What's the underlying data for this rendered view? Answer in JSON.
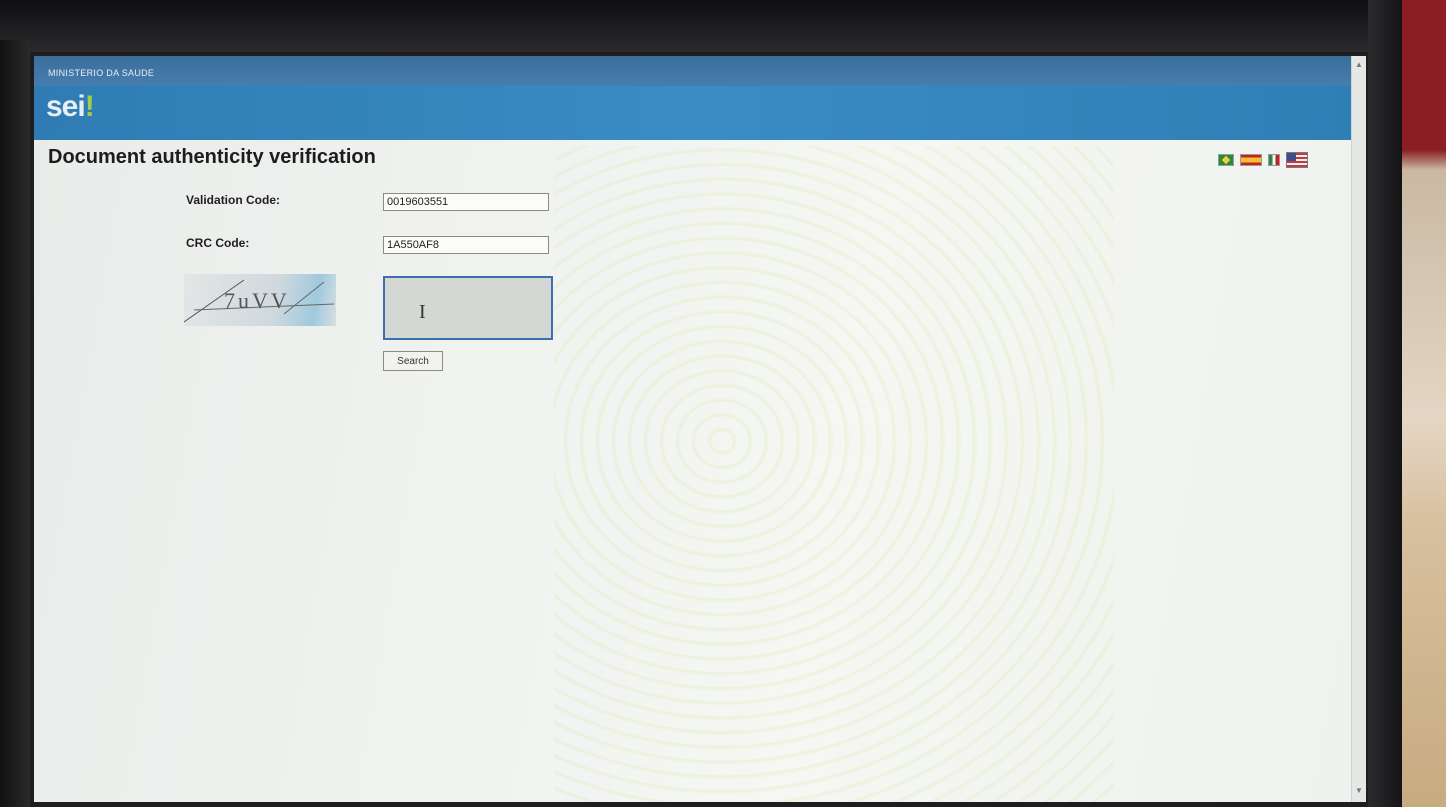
{
  "header": {
    "ministry": "MINISTERIO DA SAUDE",
    "logo_text": "sei",
    "logo_mark": "!"
  },
  "page": {
    "title": "Document authenticity verification"
  },
  "languages": [
    {
      "name": "Portuguese (Brazil) flag-icon"
    },
    {
      "name": "Spanish flag-icon"
    },
    {
      "name": "Italian flag-icon"
    },
    {
      "name": "English (US) flag-icon"
    }
  ],
  "form": {
    "validation_code_label": "Validation Code:",
    "validation_code_value": "0019603551",
    "crc_code_label": "CRC Code:",
    "crc_code_value": "1A550AF8",
    "captcha_text": "7uVV",
    "captcha_input_value": "",
    "cursor_glyph": "I",
    "search_label": "Search"
  },
  "colors": {
    "header_band": "#3a8cc4",
    "header_strip": "#3b6e9a",
    "logo_accent": "#9ed04a",
    "captcha_input_border": "#3b6fb0"
  }
}
